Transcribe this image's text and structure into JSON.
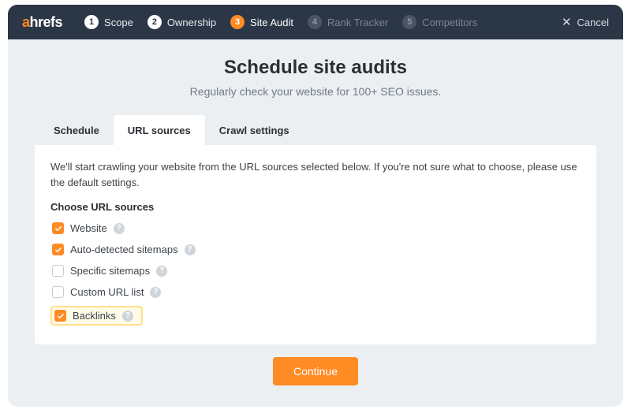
{
  "brand": {
    "a": "a",
    "rest": "hrefs"
  },
  "steps": [
    {
      "num": "1",
      "label": "Scope",
      "state": "done"
    },
    {
      "num": "2",
      "label": "Ownership",
      "state": "done"
    },
    {
      "num": "3",
      "label": "Site Audit",
      "state": "active"
    },
    {
      "num": "4",
      "label": "Rank Tracker",
      "state": "future"
    },
    {
      "num": "5",
      "label": "Competitors",
      "state": "future"
    }
  ],
  "cancel_label": "Cancel",
  "page": {
    "title": "Schedule site audits",
    "subtitle": "Regularly check your website for 100+ SEO issues."
  },
  "tabs": [
    {
      "label": "Schedule",
      "active": false
    },
    {
      "label": "URL sources",
      "active": true
    },
    {
      "label": "Crawl settings",
      "active": false
    }
  ],
  "panel": {
    "description": "We'll start crawling your website from the URL sources selected below. If you're not sure what to choose, please use the default settings.",
    "group_label": "Choose URL sources",
    "options": [
      {
        "label": "Website",
        "checked": true,
        "highlight": false
      },
      {
        "label": "Auto-detected sitemaps",
        "checked": true,
        "highlight": false
      },
      {
        "label": "Specific sitemaps",
        "checked": false,
        "highlight": false
      },
      {
        "label": "Custom URL list",
        "checked": false,
        "highlight": false
      },
      {
        "label": "Backlinks",
        "checked": true,
        "highlight": true
      }
    ]
  },
  "continue_label": "Continue",
  "help_glyph": "?"
}
